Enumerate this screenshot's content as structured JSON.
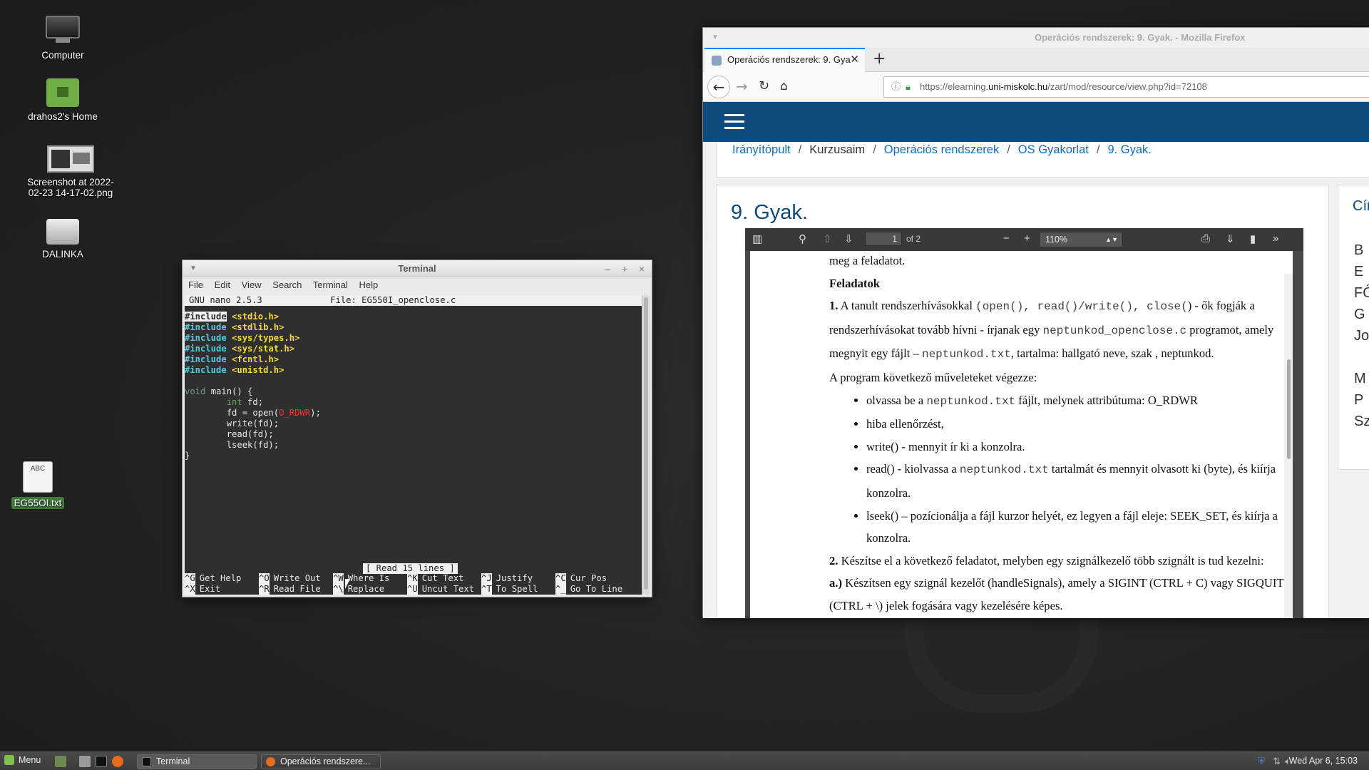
{
  "desktop": {
    "icons": [
      {
        "label": "Computer"
      },
      {
        "label": "drahos2's Home"
      },
      {
        "label": "Screenshot at 2022-02-23 14-17-02.png"
      },
      {
        "label": "DALINKA"
      },
      {
        "label": "EG55OI.txt",
        "thumb": "ABC"
      }
    ]
  },
  "terminal": {
    "title": "Terminal",
    "controls": [
      "–",
      "+",
      "×"
    ],
    "menu": [
      "File",
      "Edit",
      "View",
      "Search",
      "Terminal",
      "Help"
    ],
    "nano_version": "GNU nano 2.5.3",
    "file_label": "File: EG550I_openclose.c",
    "includes": [
      "<stdio.h>",
      "<stdlib.h>",
      "<sys/types.h>",
      "<sys/stat.h>",
      "<fcntl.h>",
      "<unistd.h>"
    ],
    "include_kw": "#include",
    "code_void": "void",
    "code_main": " main() {",
    "code_int": "int",
    "code_fd_decl": " fd;",
    "code_open_pre": "fd = open(",
    "code_open_const": "O_RDWR",
    "code_open_post": ");",
    "code_write": "write(fd);",
    "code_read": "read(fd);",
    "code_lseek": "lseek(fd);",
    "code_close_brace": "}",
    "status_message": "[ Read 15 lines ]",
    "shortcuts_row1": [
      {
        "key": "^G",
        "label": "Get Help"
      },
      {
        "key": "^O",
        "label": "Write Out"
      },
      {
        "key": "^W",
        "label": "Where Is"
      },
      {
        "key": "^K",
        "label": "Cut Text"
      },
      {
        "key": "^J",
        "label": "Justify"
      },
      {
        "key": "^C",
        "label": "Cur Pos"
      }
    ],
    "shortcuts_row2": [
      {
        "key": "^X",
        "label": "Exit"
      },
      {
        "key": "^R",
        "label": "Read File"
      },
      {
        "key": "^\\",
        "label": "Replace"
      },
      {
        "key": "^U",
        "label": "Uncut Text"
      },
      {
        "key": "^T",
        "label": "To Spell"
      },
      {
        "key": "^_",
        "label": "Go To Line"
      }
    ]
  },
  "firefox": {
    "window_title": "Operációs rendszerek: 9. Gyak. - Mozilla Firefox",
    "tab_title": "Operációs rendszerek: 9. Gya",
    "url_prefix": "https://elearning.",
    "url_domain": "uni-miskolc.hu",
    "url_suffix": "/zart/mod/resource/view.php?id=72108",
    "breadcrumbs": [
      "Irányítópult",
      "Kurzusaim",
      "Operációs rendszerek",
      "OS Gyakorlat",
      "9. Gyak."
    ],
    "page_heading": "9. Gyak.",
    "side_heading": "Cím",
    "side_letters": [
      "B",
      "E",
      "FŐ",
      "G",
      "Jo",
      "M",
      "P",
      "Sz"
    ],
    "pdf": {
      "page_number": "1",
      "page_of": "of 2",
      "zoom": "110%",
      "lines": {
        "l0": "meg a feladatot.",
        "heading": "Feladatok",
        "p1_num": "1.",
        "p1_a": " A tanult rendszerhívásokkal ",
        "p1_code1": "(open(), read()/write(), close(",
        "p1_b": ") - ők fogják a rendszerhívásokat tovább hívni - írjanak egy ",
        "p1_code2": "neptunkod_openclose.c",
        "p1_c": " programot, amely megnyit egy fájlt – ",
        "p1_code3": "neptunkod.txt",
        "p1_d": ", tartalma: hallgató neve, szak , neptunkod.",
        "p2": "A program következő műveleteket végezze:",
        "b1_a": "olvassa be a ",
        "b1_code": "neptunkod.txt",
        "b1_b": " fájlt, melynek attribútuma: O_RDWR",
        "b2": "hiba ellenőrzést,",
        "b3": "write() -  mennyit ír ki a konzolra.",
        "b4_a": "read() - kiolvassa a ",
        "b4_code": "neptunkod.txt",
        "b4_b": " tartalmát és mennyit olvasott ki (byte), és kiírja konzolra.",
        "b5": "lseek() – pozícionálja a fájl kurzor helyét, ez legyen a fájl eleje: SEEK_SET, és kiírja a konzolra.",
        "p3_num": "2.",
        "p3": " Készítse el a következő feladatot, melyben egy szignálkezelő több szignált is tud kezelni:",
        "p4_num": "a.)",
        "p4": " Készítsen egy szignál kezelőt (handleSignals), amely a SIGINT (CTRL + C) vagy SIGQUIT (CTRL + \\) jelek fogására vagy kezelésére képes."
      }
    }
  },
  "taskbar": {
    "menu_label": "Menu",
    "windows": [
      "Terminal",
      "Operációs rendszere..."
    ],
    "clock": "Wed Apr 6, 15:03"
  }
}
